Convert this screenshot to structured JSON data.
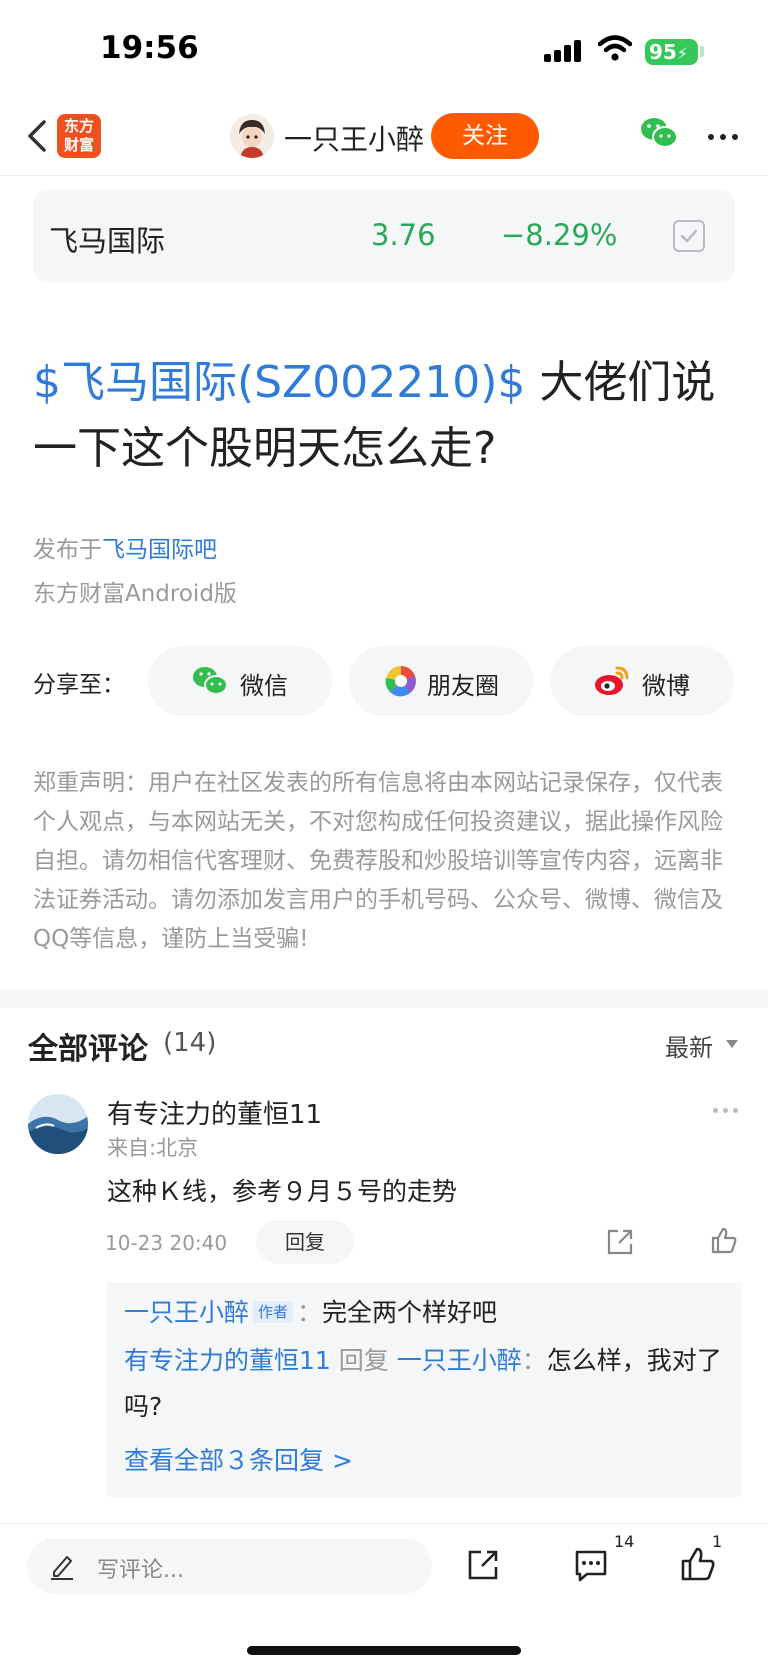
{
  "status_bar": {
    "time": "19:56",
    "battery": "95"
  },
  "nav": {
    "logo_text": "东方\n财富",
    "author_name": "一只王小醉",
    "follow_label": "关注"
  },
  "stock": {
    "name": "飞马国际",
    "price": "3.76",
    "change": "−8.29%"
  },
  "post": {
    "title_tag": "$飞马国际(SZ002210)$",
    "title_text": " 大佬们说一下这个股明天怎么走?",
    "published_prefix": "发布于",
    "forum_link": "飞马国际吧",
    "source": "东方财富Android版"
  },
  "share": {
    "label": "分享至：",
    "buttons": [
      {
        "label": "微信",
        "icon": "wechat-icon"
      },
      {
        "label": "朋友圈",
        "icon": "moments-icon"
      },
      {
        "label": "微博",
        "icon": "weibo-icon"
      }
    ]
  },
  "disclaimer": "郑重声明：用户在社区发表的所有信息将由本网站记录保存，仅代表个人观点，与本网站无关，不对您构成任何投资建议，据此操作风险自担。请勿相信代客理财、免费荐股和炒股培训等宣传内容，远离非法证券活动。请勿添加发言用户的手机号码、公众号、微博、微信及QQ等信息，谨防上当受骗!",
  "comments_header": {
    "title": "全部评论",
    "count": "(14)",
    "sort": "最新"
  },
  "comment": {
    "user": "有专注力的董恒11",
    "location": "来自:北京",
    "text": "这种Ｋ线，参考９月５号的走势",
    "datetime": "10-23 20:40",
    "reply_label": "回复"
  },
  "replies": {
    "r1_user": "一只王小醉",
    "r1_tag": "作者",
    "r1_sep": "：",
    "r1_text": "完全两个样好吧",
    "r2_user": "有专注力的董恒11",
    "r2_mid": " 回复 ",
    "r2_target": "一只王小醉",
    "r2_sep": "：",
    "r2_text": "怎么样，我对了吗?",
    "view_all": "查看全部３条回复 >"
  },
  "bottom_bar": {
    "placeholder": "写评论...",
    "comment_count": "14",
    "like_count": "1"
  }
}
